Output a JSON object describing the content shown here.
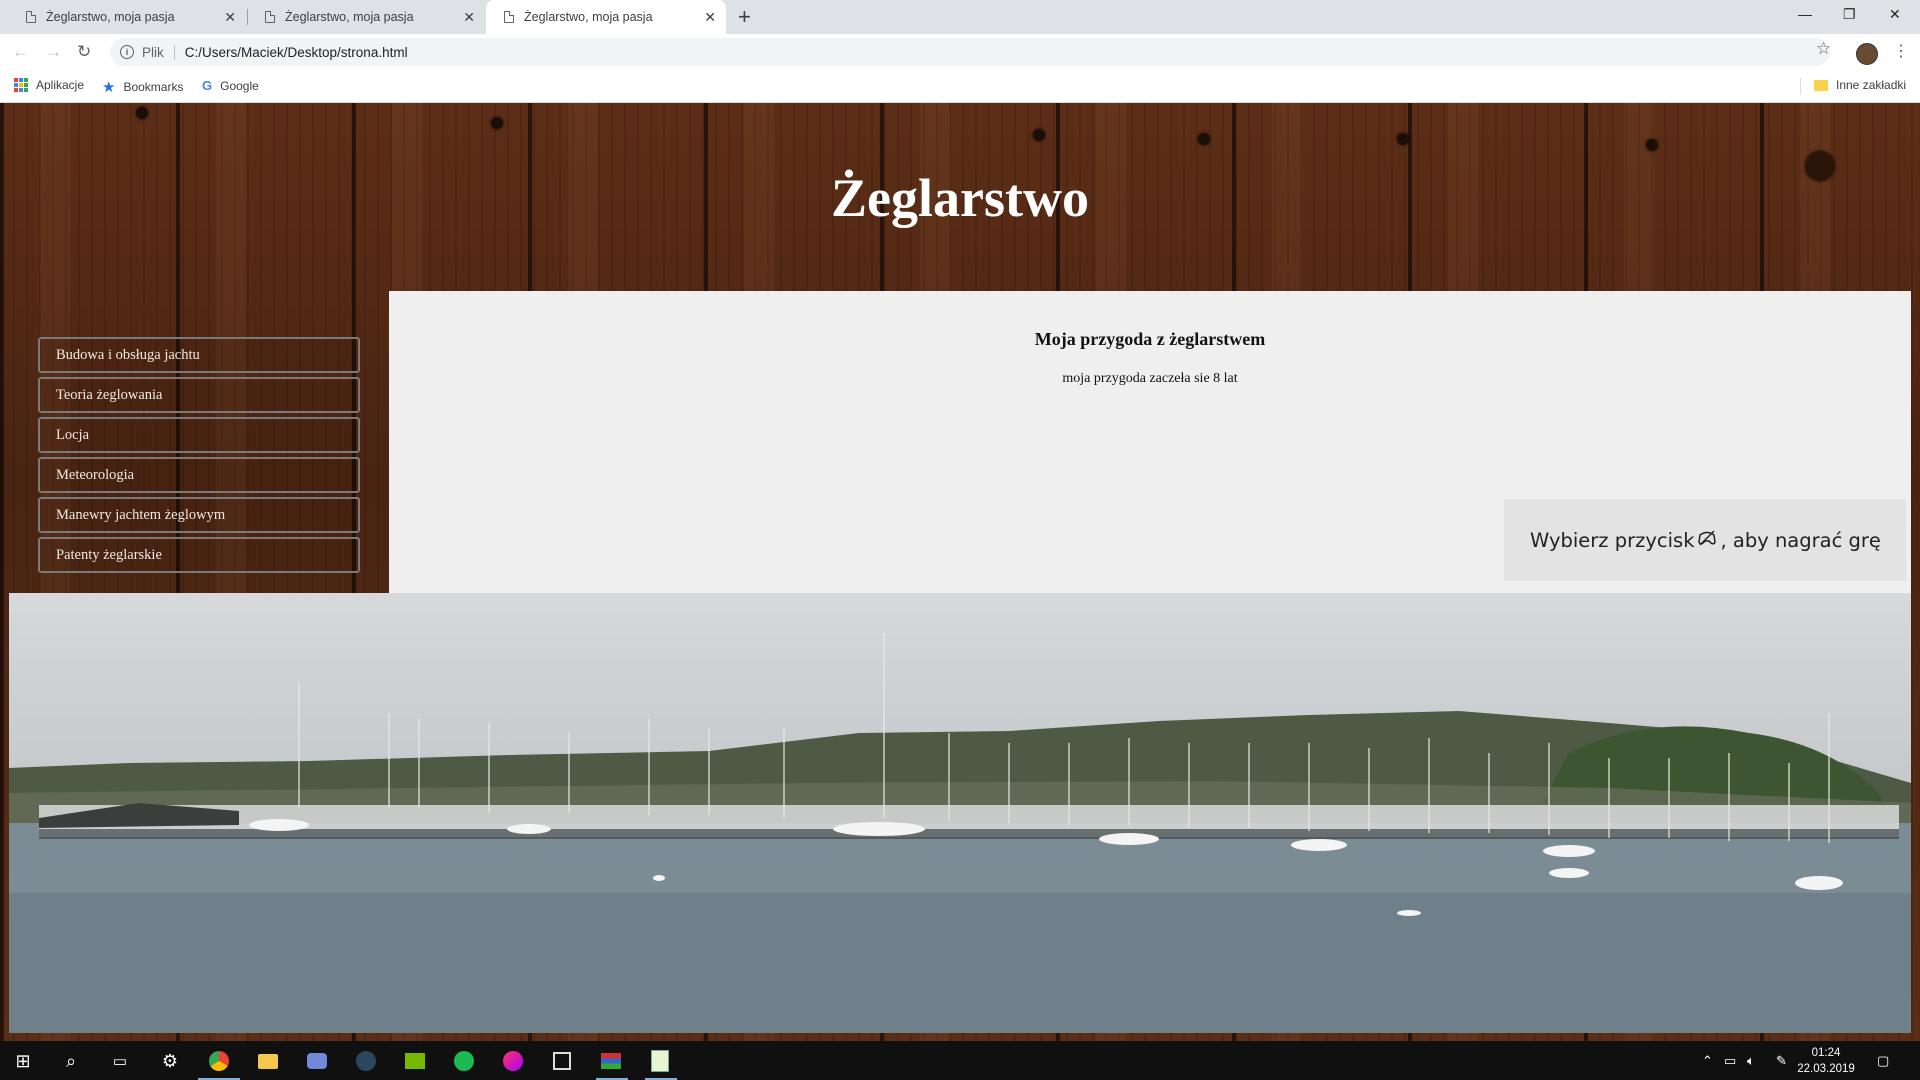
{
  "browser": {
    "tabs": [
      {
        "title": "Żeglarstwo, moja pasja",
        "active": false
      },
      {
        "title": "Żeglarstwo, moja pasja",
        "active": false
      },
      {
        "title": "Żeglarstwo, moja pasja",
        "active": true
      }
    ],
    "address": {
      "scheme_label": "Plik",
      "url": "C:/Users/Maciek/Desktop/strona.html"
    },
    "bookmarks": [
      {
        "label": "Aplikacje",
        "icon": "apps-grid-icon"
      },
      {
        "label": "Bookmarks",
        "icon": "star-icon"
      },
      {
        "label": "Google",
        "icon": "google-icon"
      }
    ],
    "other_bookmarks": "Inne zakładki"
  },
  "page": {
    "site_title": "Żeglarstwo",
    "nav": [
      {
        "label": "Budowa i obsługa jachtu"
      },
      {
        "label": "Teoria żeglowania"
      },
      {
        "label": "Locja"
      },
      {
        "label": "Meteorologia"
      },
      {
        "label": "Manewry jachtem żeglowym"
      },
      {
        "label": "Patenty żeglarskie"
      }
    ],
    "content": {
      "heading": "Moja przygoda z żeglarstwem",
      "text": "moja przygoda zaczeła sie 8 lat"
    },
    "harbor_image": "harbor-marina-photo"
  },
  "overlay": {
    "game_bar_tip_before": "Wybierz przycisk",
    "game_bar_tip_after": ", aby nagrać grę",
    "icon": "gamepad-record-icon"
  },
  "taskbar": {
    "time": "01:24",
    "date": "22.03.2019",
    "apps": [
      "start-icon",
      "search-icon",
      "task-view-icon",
      "settings-icon",
      "chrome-icon",
      "file-explorer-icon",
      "discord-icon",
      "steam-icon",
      "nvidia-icon",
      "spotify-icon",
      "itunes-icon",
      "unity-icon",
      "winrar-icon",
      "notepad-icon"
    ]
  },
  "colors": {
    "wood": "#4a2412",
    "panel": "#efefef",
    "title_text": "#ffffff"
  }
}
